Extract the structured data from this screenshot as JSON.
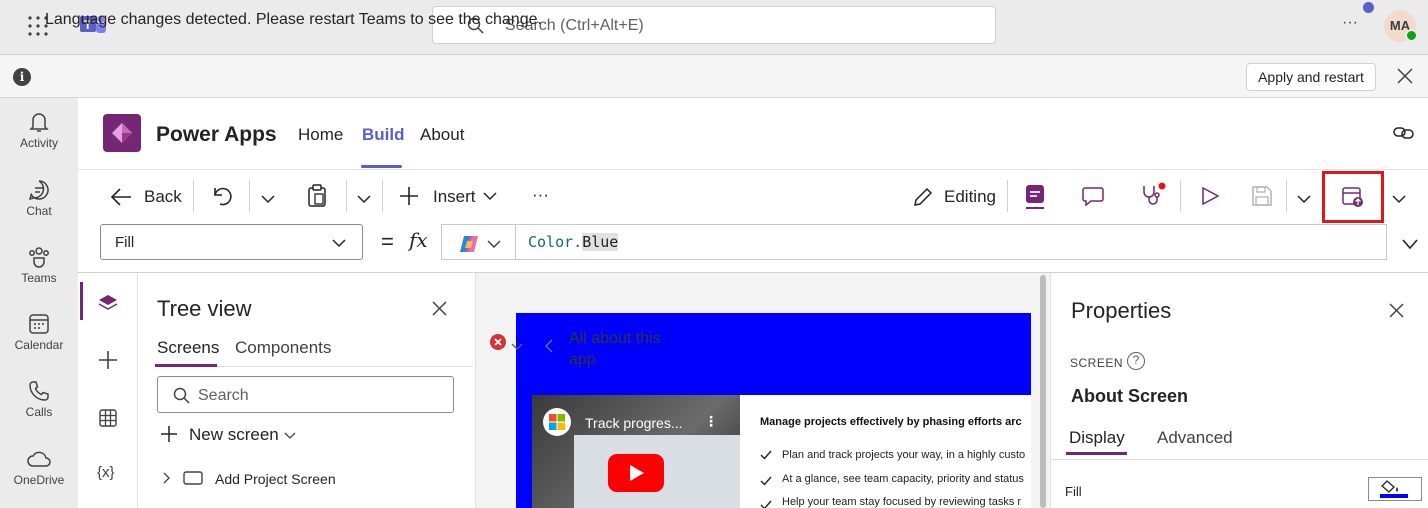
{
  "topbar": {
    "search_placeholder": "Search (Ctrl+Alt+E)",
    "more_label": "···",
    "avatar_initials": "MA"
  },
  "infobar": {
    "message": "Language changes detected. Please restart Teams to see the change.",
    "apply_label": "Apply and restart"
  },
  "rail": {
    "items": [
      {
        "label": "Activity",
        "icon": "bell-icon"
      },
      {
        "label": "Chat",
        "icon": "chat-icon"
      },
      {
        "label": "Teams",
        "icon": "teams-icon"
      },
      {
        "label": "Calendar",
        "icon": "calendar-icon"
      },
      {
        "label": "Calls",
        "icon": "phone-icon"
      },
      {
        "label": "OneDrive",
        "icon": "cloud-icon"
      }
    ]
  },
  "app": {
    "title": "Power Apps",
    "tabs": [
      {
        "label": "Home"
      },
      {
        "label": "Build",
        "active": true
      },
      {
        "label": "About"
      }
    ]
  },
  "toolbar": {
    "back_label": "Back",
    "insert_label": "Insert",
    "more_label": "···",
    "editing_label": "Editing"
  },
  "formula": {
    "property": "Fill",
    "equals": "=",
    "fx": "fx",
    "expr_prefix": "Color.",
    "expr_value": "Blue"
  },
  "tree": {
    "title": "Tree view",
    "tabs": [
      "Screens",
      "Components"
    ],
    "search_placeholder": "Search",
    "new_screen_label": "New screen",
    "items": [
      "Add Project Screen"
    ]
  },
  "left_icons": {
    "variables_label": "{x}"
  },
  "canvas": {
    "screen_title": "All about this app",
    "video_title": "Track progres...",
    "card_heading": "Manage projects effectively by phasing efforts arc",
    "card_items": [
      "Plan and track projects your way, in a highly custo",
      "At a glance, see team capacity, priority and status",
      "Help your team stay focused by reviewing tasks r"
    ]
  },
  "properties": {
    "title": "Properties",
    "section_label": "SCREEN",
    "screen_name": "About Screen",
    "tabs": [
      "Display",
      "Advanced"
    ],
    "fill_label": "Fill",
    "fill_color": "#0000ff"
  },
  "colors": {
    "brand": "#742774",
    "teams_accent": "#5b5fc7",
    "highlight": "#e0161b"
  }
}
